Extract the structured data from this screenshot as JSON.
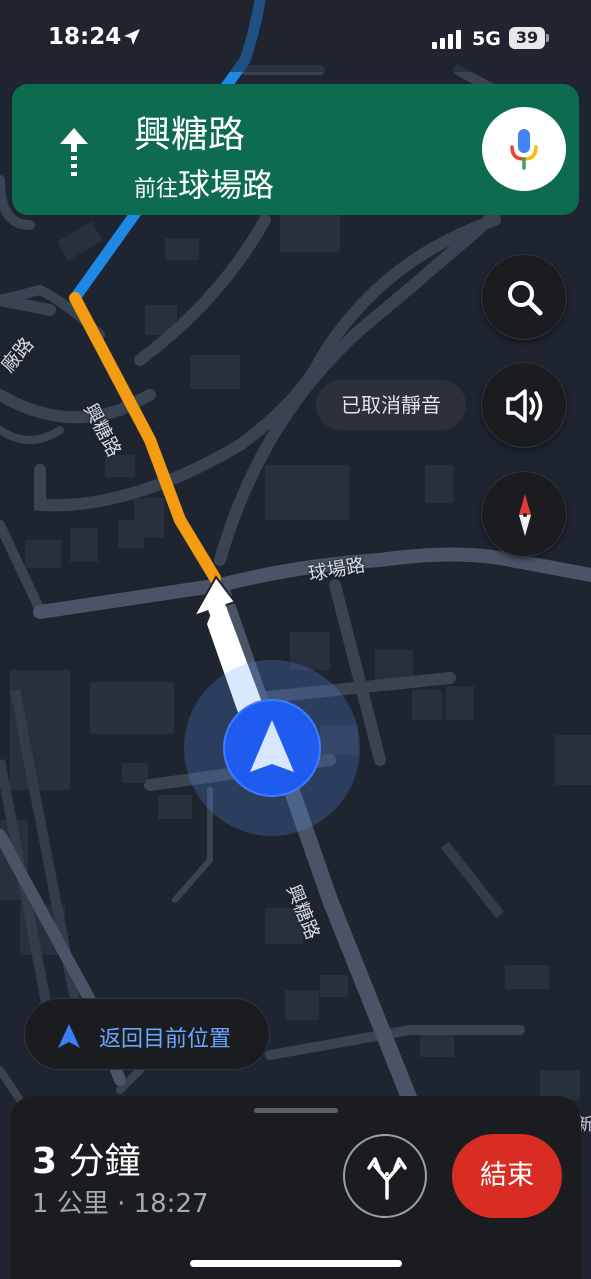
{
  "status_bar": {
    "time": "18:24",
    "network": "5G",
    "battery": "39",
    "icons": [
      "location-arrow-icon",
      "signal-bars-icon",
      "battery-icon"
    ]
  },
  "navigation": {
    "street": "興糖路",
    "toward_prefix": "前往",
    "toward_street": "球場路",
    "turn_icon": "straight-arrow-icon",
    "header_color": "#0d6b4f"
  },
  "controls": {
    "search_icon": "search-icon",
    "sound_icon": "speaker-icon",
    "compass_icon": "compass-icon",
    "unmute_label": "已取消靜音"
  },
  "map": {
    "labels": {
      "xingtang_upper": "興糖路",
      "qiuchang": "球場路",
      "xingtang_lower": "興糖路",
      "factory_partial": "廠路",
      "edge_partial": "新"
    },
    "route_colors": {
      "traffic": "#f39c12",
      "clear": "#1e88e5"
    }
  },
  "recenter": {
    "label": "返回目前位置"
  },
  "trip": {
    "duration_value": "3",
    "duration_unit": "分鐘",
    "details": "1 公里 · 18:27",
    "end_label": "結束",
    "end_color": "#d92d23"
  }
}
